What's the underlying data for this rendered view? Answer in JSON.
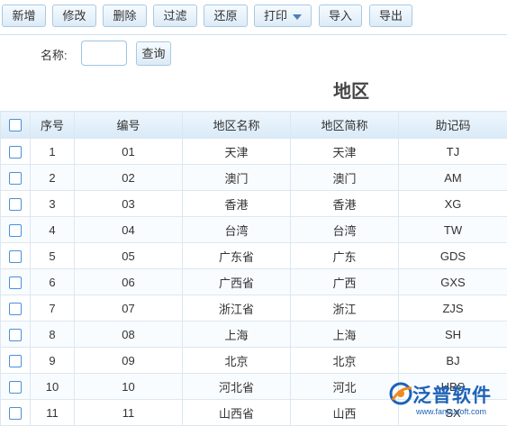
{
  "toolbar": {
    "buttons": [
      {
        "key": "add",
        "label": "新增"
      },
      {
        "key": "edit",
        "label": "修改"
      },
      {
        "key": "delete",
        "label": "删除"
      },
      {
        "key": "filter",
        "label": "过滤"
      },
      {
        "key": "restore",
        "label": "还原"
      },
      {
        "key": "print",
        "label": "打印"
      },
      {
        "key": "import",
        "label": "导入"
      },
      {
        "key": "export",
        "label": "导出"
      }
    ]
  },
  "search": {
    "label": "名称:",
    "value": "",
    "button": "查询"
  },
  "page_title": "地区",
  "table": {
    "headers": [
      "序号",
      "编号",
      "地区名称",
      "地区简称",
      "助记码"
    ],
    "rows": [
      [
        "1",
        "01",
        "天津",
        "天津",
        "TJ"
      ],
      [
        "2",
        "02",
        "澳门",
        "澳门",
        "AM"
      ],
      [
        "3",
        "03",
        "香港",
        "香港",
        "XG"
      ],
      [
        "4",
        "04",
        "台湾",
        "台湾",
        "TW"
      ],
      [
        "5",
        "05",
        "广东省",
        "广东",
        "GDS"
      ],
      [
        "6",
        "06",
        "广西省",
        "广西",
        "GXS"
      ],
      [
        "7",
        "07",
        "浙江省",
        "浙江",
        "ZJS"
      ],
      [
        "8",
        "08",
        "上海",
        "上海",
        "SH"
      ],
      [
        "9",
        "09",
        "北京",
        "北京",
        "BJ"
      ],
      [
        "10",
        "10",
        "河北省",
        "河北",
        "HBS"
      ],
      [
        "11",
        "11",
        "山西省",
        "山西",
        "SX"
      ]
    ]
  },
  "watermark": {
    "brand": "泛普软件",
    "url": "www.fanpusoft.com"
  },
  "colors": {
    "accent": "#4a90d9",
    "header_bg": "#d9eaf8",
    "button_border": "#a9c9e2",
    "brand": "#1d62b8"
  }
}
